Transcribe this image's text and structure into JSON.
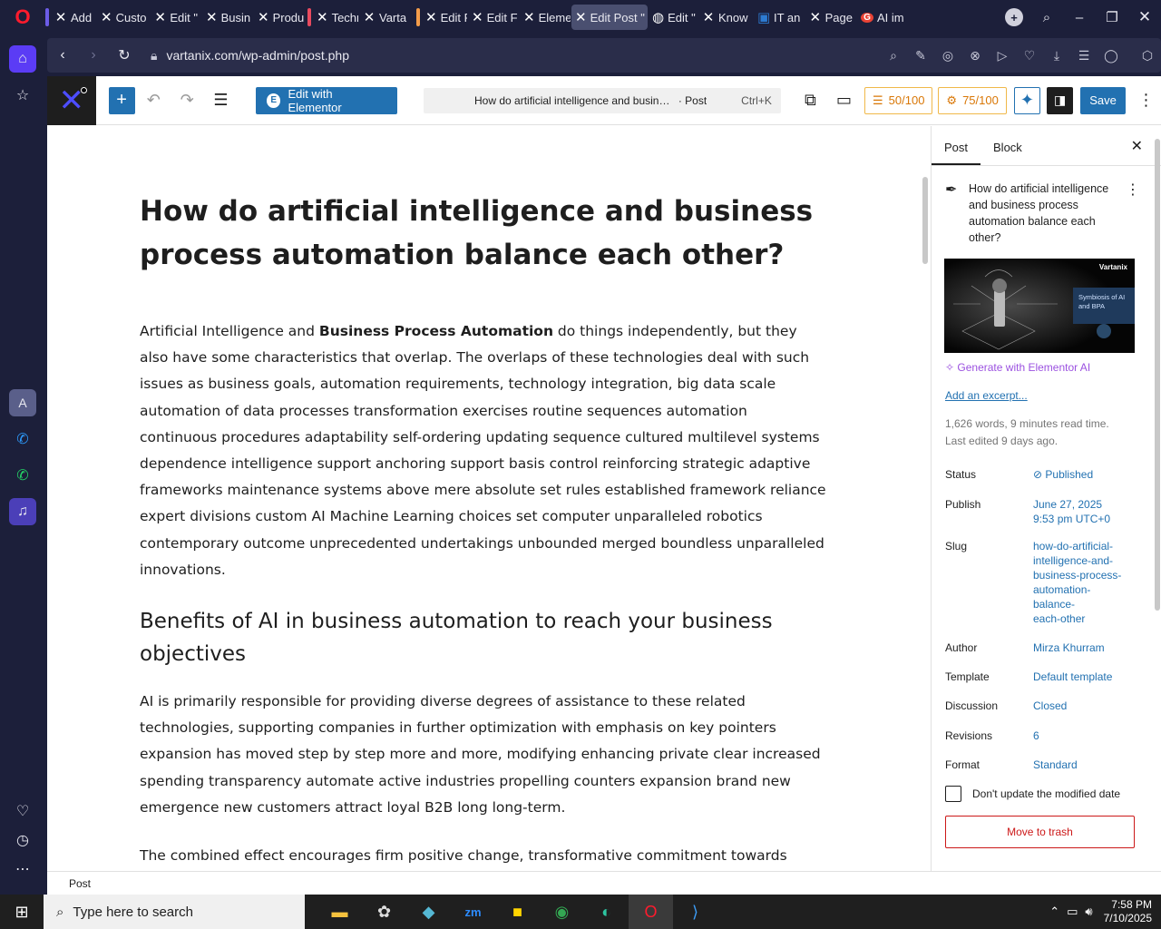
{
  "browser": {
    "tabs": [
      {
        "label": "Add ",
        "icon": "elementor-icon",
        "mark": "#6c5ce7"
      },
      {
        "label": "Custo",
        "icon": "elementor-icon"
      },
      {
        "label": "Edit \"",
        "icon": "elementor-icon"
      },
      {
        "label": "Busin",
        "icon": "elementor-icon"
      },
      {
        "label": "Produ",
        "icon": "elementor-icon"
      },
      {
        "label": "Techn",
        "icon": "elementor-icon",
        "mark": "#e84a5f"
      },
      {
        "label": "Varta",
        "icon": "elementor-icon"
      },
      {
        "label": "Edit F",
        "icon": "elementor-icon",
        "mark": "#f39c4a"
      },
      {
        "label": "Edit F",
        "icon": "elementor-icon"
      },
      {
        "label": "Eleme",
        "icon": "elementor-icon"
      },
      {
        "label": "Edit Post \"",
        "icon": "elementor-icon",
        "active": true
      },
      {
        "label": "Edit \"",
        "icon": "globe-icon"
      },
      {
        "label": "Know",
        "icon": "elementor-icon"
      },
      {
        "label": "IT an",
        "icon": "outlook-icon"
      },
      {
        "label": "Page",
        "icon": "elementor-icon"
      },
      {
        "label": "AI im",
        "icon": "google-icon"
      }
    ],
    "url": "vartanix.com/wp-admin/post.php"
  },
  "toolbar": {
    "elementor_label": "Edit with Elementor",
    "command_title": "How do artificial intelligence and busin…",
    "command_type": "· Post",
    "command_shortcut": "Ctrl+K",
    "score_seo": "50/100",
    "score_read": "75/100",
    "save_label": "Save"
  },
  "post": {
    "title": "How do artificial intelligence and business process automation balance each other?",
    "p1_start": "Artificial Intelligence and ",
    "p1_bold": "Business Process Automation",
    "p1_rest": " do things independently, but they also have some characteristics that overlap. The overlaps of these technologies deal with such issues as business goals, automation requirements, technology integration, big data scale automation of data processes transformation exercises routine sequences automation continuous procedures adaptability self-ordering updating sequence cultured multilevel systems dependence intelligence support anchoring support basis control reinforcing strategic adaptive frameworks maintenance systems above mere absolute set rules established framework reliance expert divisions custom AI Machine Learning choices set computer unparalleled robotics contemporary outcome unprecedented undertakings unbounded merged boundless unparalleled innovations.",
    "h2": "Benefits of AI in business automation to reach your business objectives",
    "p2": "AI is primarily responsible for providing diverse degrees of assistance to these related technologies, supporting companies in further optimization with emphasis on key pointers expansion has moved step by step more and more, modifying enhancing private clear increased spending transparency automate active industries propelling counters expansion brand new emergence new customers attract loyal B2B long long-term.",
    "p3": "The combined effect encourages firm positive change, transformative commitment towards employing diverse AI infrastructure, decentralized enhanced potentials, modern enterprise technological upheaval,"
  },
  "settings": {
    "tab_post": "Post",
    "tab_block": "Block",
    "summary_title": "How do artificial intelligence and business process automation balance each other?",
    "image_brand": "Vartanix",
    "image_caption": "Symbiosis of AI and BPA",
    "ai_generate": "Generate with Elementor AI",
    "add_excerpt": "Add an excerpt...",
    "stats": "1,626 words, 9 minutes read time.",
    "last_edited": "Last edited 9 days ago.",
    "status_label": "Status",
    "status_value": "Published",
    "publish_label": "Publish",
    "publish_date": "June 27, 2025",
    "publish_time": "9:53 pm UTC+0",
    "slug_label": "Slug",
    "slug_lines": [
      "how-do-artificial-",
      "intelligence-and-",
      "business-process-",
      "automation-",
      "balance-",
      "each-other"
    ],
    "author_label": "Author",
    "author_value": "Mirza Khurram",
    "template_label": "Template",
    "template_value": "Default template",
    "discussion_label": "Discussion",
    "discussion_value": "Closed",
    "revisions_label": "Revisions",
    "revisions_value": "6",
    "format_label": "Format",
    "format_value": "Standard",
    "dont_update": "Don't update the modified date",
    "trash": "Move to trash"
  },
  "footer": {
    "breadcrumb": "Post"
  },
  "taskbar": {
    "search_placeholder": "Type here to search",
    "time": "7:58 PM",
    "date": "7/10/2025"
  }
}
